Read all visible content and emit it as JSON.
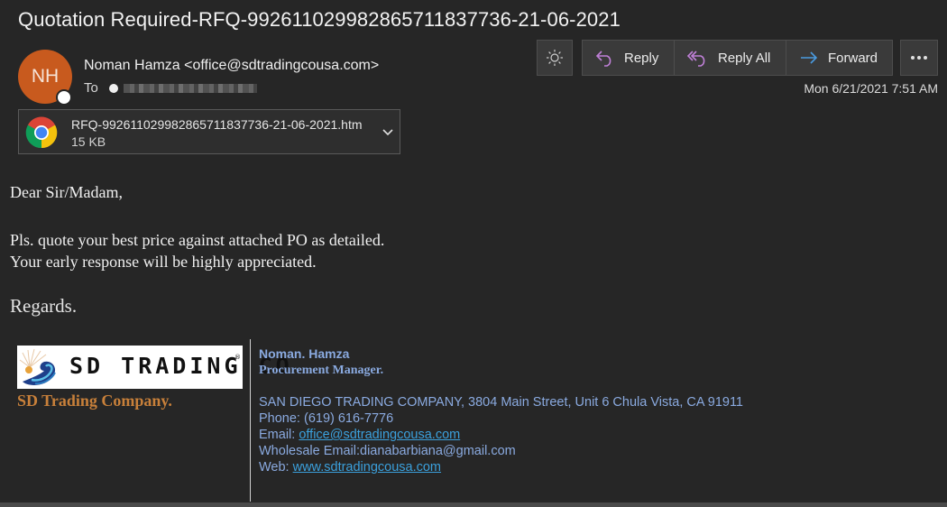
{
  "email": {
    "subject": "Quotation Required-RFQ-99261102998286571183773​6-21-06-2021",
    "sender": {
      "initials": "NH",
      "display": "Noman Hamza <office@sdtradingcousa.com>",
      "avatar_color": "#c85a1e"
    },
    "to_label": "To",
    "to_recipient": "[redacted]",
    "date": "Mon 6/21/2021 7:51 AM",
    "attachment": {
      "icon": "chrome-icon",
      "filename": "RFQ-99261102998286571183773​6-21-06-2021.htm",
      "size": "15 KB"
    }
  },
  "toolbar": {
    "theme_icon": "sun-icon",
    "reply_label": "Reply",
    "reply_all_label": "Reply All",
    "forward_label": "Forward",
    "more_icon": "ellipsis-icon",
    "reply_color": "#c080d8",
    "forward_color": "#4a9be0"
  },
  "body": {
    "greeting": "Dear Sir/Madam,",
    "line1": "Pls. quote your best price against attached PO as detailed.",
    "line2": "Your early response will be highly appreciated.",
    "closing": "Regards."
  },
  "signature": {
    "logo_text": "SD TRADING CO",
    "logo_reg": "®",
    "company_name": "SD Trading Company.",
    "name": "Noman. Hamza",
    "title": "Procurement Manager.",
    "address": "SAN DIEGO TRADING COMPANY, 3804 Main Street, Unit 6 Chula Vista, CA 91911",
    "phone": "Phone: (619) 616-7776",
    "email_label": "Email: ",
    "email": "office@sdtradingcousa.com",
    "wholesale": "Wholesale Email:dianabarbiana@gmail.com",
    "web_label": "Web: ",
    "web": "www.sdtradingcousa.com"
  }
}
